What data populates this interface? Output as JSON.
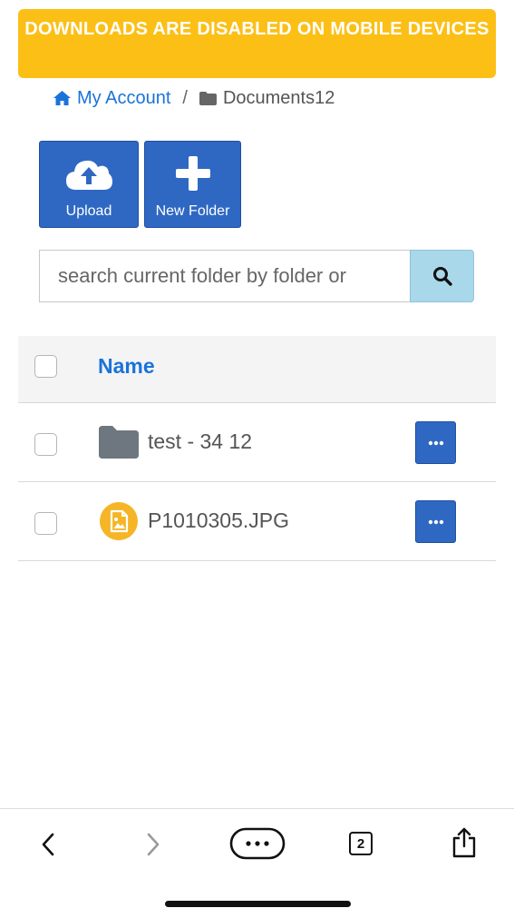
{
  "banner": {
    "text": "DOWNLOADS ARE DISABLED ON MOBILE DEVICES"
  },
  "breadcrumb": {
    "home_label": "My Account",
    "separator": "/",
    "current_label": "Documents12"
  },
  "toolbar": {
    "upload_label": "Upload",
    "new_folder_label": "New Folder"
  },
  "search": {
    "placeholder": "search current folder by folder or"
  },
  "table": {
    "header_name": "Name",
    "rows": [
      {
        "type": "folder",
        "icon": "folder-icon",
        "name": "test - 34 12"
      },
      {
        "type": "image",
        "icon": "image-file-icon",
        "name": "P1010305.JPG"
      }
    ]
  },
  "browser_bar": {
    "tab_count": "2",
    "icons": [
      "back-icon",
      "forward-icon",
      "more-options-icon",
      "tabs-icon",
      "share-icon"
    ]
  },
  "colors": {
    "banner": "#fbbf16",
    "primary_button": "#2f68c2",
    "link": "#1a73d9",
    "search_button": "#a9d8ea",
    "folder_icon": "#6e7780",
    "image_badge": "#f5b526"
  }
}
